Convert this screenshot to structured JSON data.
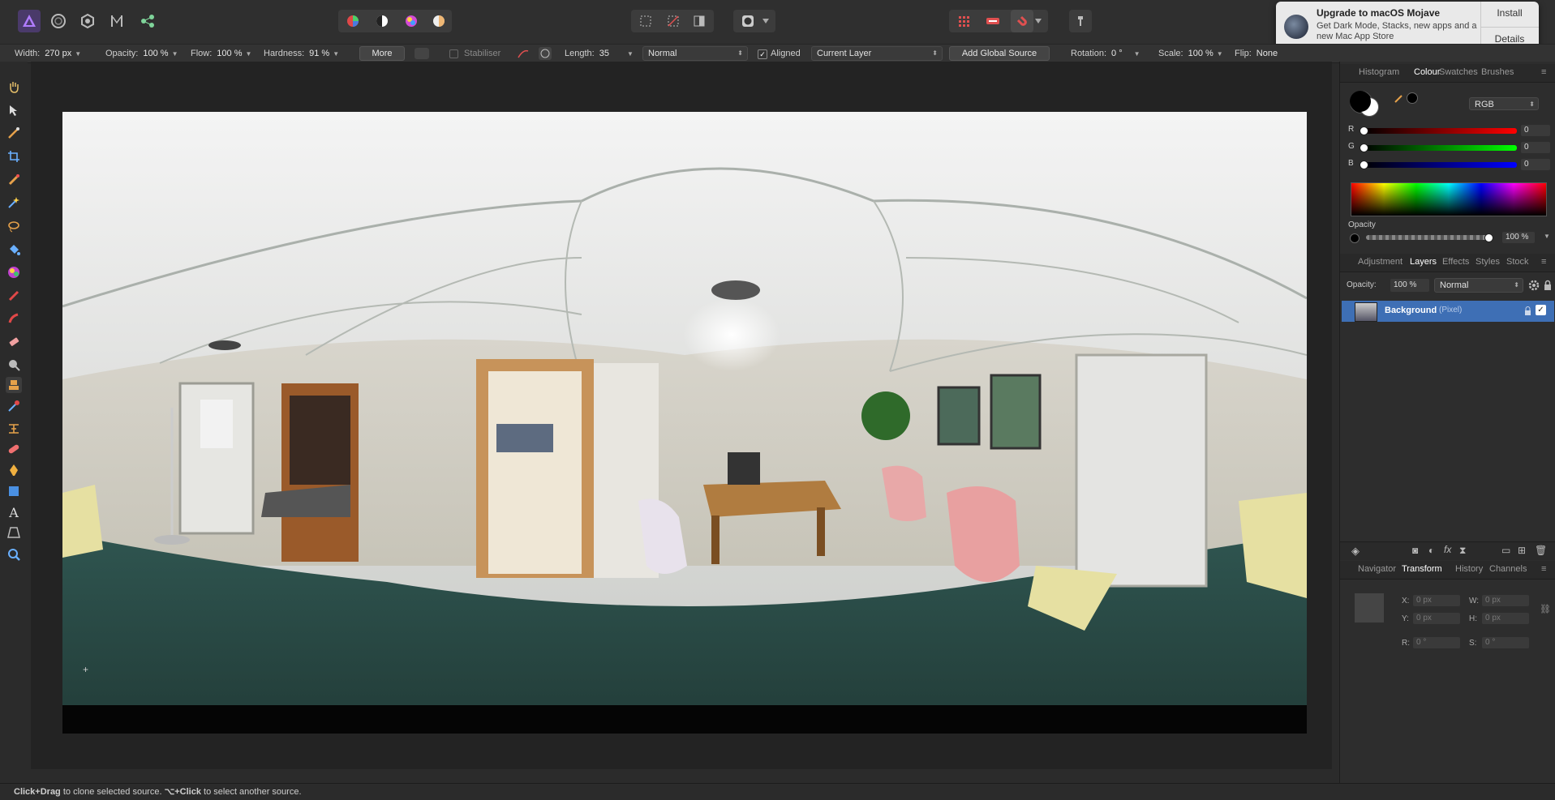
{
  "app": {
    "name": "Affinity Photo"
  },
  "persona_icons": [
    "photo-persona-icon",
    "liquify-persona-icon",
    "develop-persona-icon",
    "tone-mapping-persona-icon",
    "export-persona-icon"
  ],
  "context": {
    "width_label": "Width:",
    "width_value": "270 px",
    "opacity_label": "Opacity:",
    "opacity_value": "100 %",
    "flow_label": "Flow:",
    "flow_value": "100 %",
    "hardness_label": "Hardness:",
    "hardness_value": "91 %",
    "more_label": "More",
    "stabiliser_label": "Stabiliser",
    "length_label": "Length:",
    "length_value": "35",
    "blend_mode": "Normal",
    "aligned_label": "Aligned",
    "source_layer": "Current Layer",
    "add_global_source_label": "Add Global Source",
    "rotation_label": "Rotation:",
    "rotation_value": "0 °",
    "scale_label": "Scale:",
    "scale_value": "100 %",
    "flip_label": "Flip:",
    "flip_value": "None"
  },
  "notification": {
    "title": "Upgrade to macOS Mojave",
    "body": "Get Dark Mode, Stacks, new apps and a new Mac App Store",
    "install_label": "Install",
    "details_label": "Details"
  },
  "colour_panel": {
    "tabs": [
      "Histogram",
      "Colour",
      "Swatches",
      "Brushes"
    ],
    "active_tab": "Colour",
    "model": "RGB",
    "r_label": "R",
    "r_value": "0",
    "g_label": "G",
    "g_value": "0",
    "b_label": "B",
    "b_value": "0",
    "opacity_label": "Opacity",
    "opacity_value": "100 %"
  },
  "layers_panel": {
    "tabs": [
      "Adjustment",
      "Layers",
      "Effects",
      "Styles",
      "Stock"
    ],
    "active_tab": "Layers",
    "opacity_label": "Opacity:",
    "opacity_value": "100 %",
    "blend_mode": "Normal",
    "layers": [
      {
        "name": "Background",
        "type": "(Pixel)"
      }
    ]
  },
  "transform_panel": {
    "tabs": [
      "Navigator",
      "Transform",
      "History",
      "Channels"
    ],
    "active_tab": "Transform",
    "x_label": "X:",
    "x_value": "0 px",
    "y_label": "Y:",
    "y_value": "0 px",
    "w_label": "W:",
    "w_value": "0 px",
    "h_label": "H:",
    "h_value": "0 px",
    "r_label": "R:",
    "r_value": "0 °",
    "s_label": "S:",
    "s_value": "0 °"
  },
  "status": {
    "part1_bold": "Click+Drag",
    "part1": " to clone selected source. ",
    "part2_bold": "⌥+Click",
    "part2": " to select another source."
  },
  "colors": {
    "accent": "#2b6ed9",
    "selection": "#3e6fb5"
  }
}
